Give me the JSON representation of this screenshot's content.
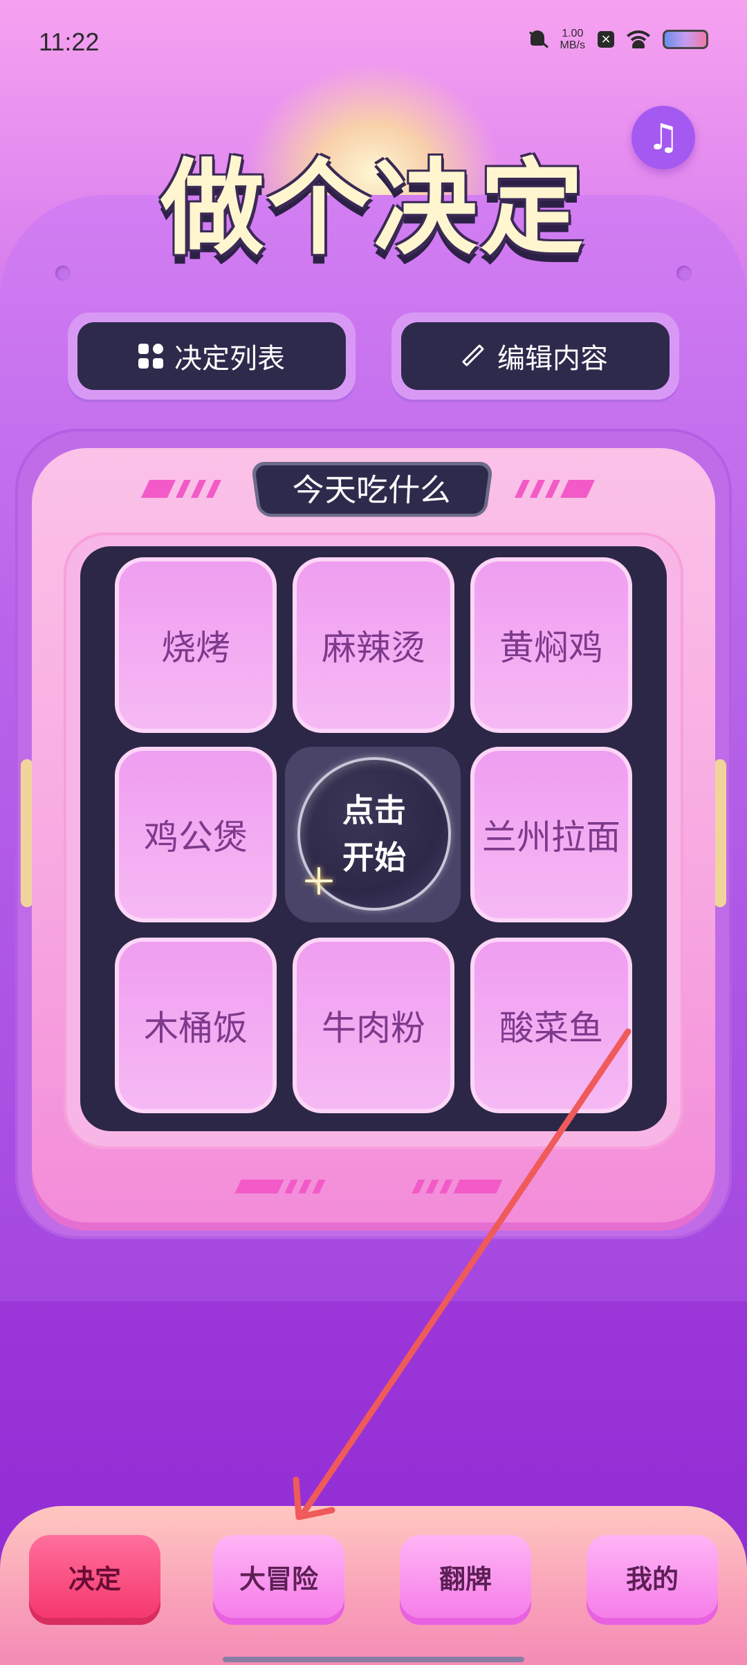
{
  "status_bar": {
    "time": "11:22",
    "speed_value": "1.00",
    "speed_unit": "MB/s"
  },
  "header": {
    "title": "做个决定",
    "music_icon": "music-note-icon"
  },
  "toolbar": {
    "list_label": "决定列表",
    "edit_label": "编辑内容"
  },
  "machine": {
    "topic": "今天吃什么",
    "start_line1": "点击",
    "start_line2": "开始",
    "options": [
      "烧烤",
      "麻辣烫",
      "黄焖鸡",
      "鸡公煲",
      "兰州拉面",
      "木桶饭",
      "牛肉粉",
      "酸菜鱼"
    ]
  },
  "nav": {
    "tabs": [
      "决定",
      "大冒险",
      "翻牌",
      "我的"
    ],
    "active": "决定"
  },
  "colors": {
    "accent_red": "#f5386e",
    "board": "#2c2747",
    "annotation_arrow": "#ef5a5a"
  }
}
